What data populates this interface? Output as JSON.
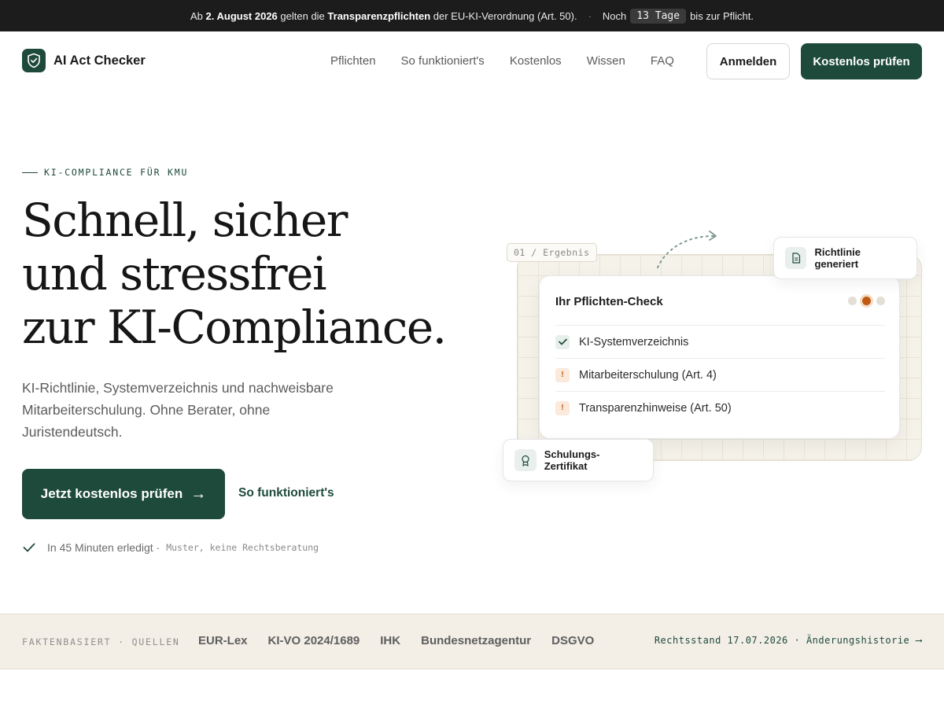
{
  "topbar": {
    "prefix": "Ab ",
    "date": "2. August 2026",
    "middle": " gelten die ",
    "duty": "Transparenzpflichten",
    "suffix": " der EU-KI-Verordnung (Art. 50).",
    "separator": "·",
    "countdown_prefix": "Noch",
    "countdown_value": "13 Tage",
    "countdown_suffix": "bis zur Pflicht."
  },
  "header": {
    "logo_text": "AI Act Checker",
    "logo_icon": "shield-check-icon",
    "nav": [
      "Pflichten",
      "So funktioniert's",
      "Kostenlos",
      "Wissen",
      "FAQ"
    ],
    "login_label": "Anmelden",
    "cta_label": "Kostenlos prüfen"
  },
  "hero": {
    "eyebrow": "KI-COMPLIANCE FÜR KMU",
    "headline": [
      "Schnell, sicher",
      "und stressfrei",
      "zur KI-Compliance."
    ],
    "subtext": "KI-Richtlinie, Systemverzeichnis und nachweisbare Mitarbeiterschulung. Ohne Berater, ohne Juristendeutsch.",
    "cta_primary": "Jetzt kostenlos prüfen",
    "cta_arrow": "→",
    "cta_secondary": "So funktioniert's",
    "note_text": "In 45 Minuten erledigt ·",
    "note_mono": "Muster, keine Rechtsberatung"
  },
  "illustration": {
    "result_tag": "01 / Ergebnis",
    "card_title": "Ihr Pflichten-Check",
    "rows": [
      {
        "label": "KI-Systemverzeichnis",
        "status": "ok",
        "icon": "check-icon"
      },
      {
        "label": "Mitarbeiterschulung (Art. 4)",
        "status": "warn",
        "icon": "exclamation-icon"
      },
      {
        "label": "Transparenzhinweise (Art. 50)",
        "status": "warn",
        "icon": "exclamation-icon"
      }
    ],
    "float_policy": "Richtlinie generiert",
    "float_policy_icon": "document-icon",
    "float_cert": "Schulungs-Zertifikat",
    "float_cert_icon": "award-icon",
    "accent_orange": "#c05a12",
    "accent_green": "#1e4a3b"
  },
  "sources_band": {
    "label": "FAKTENBASIERT · QUELLEN",
    "sources": [
      "EUR-Lex",
      "KI-VO 2024/1689",
      "IHK",
      "Bundesnetzagentur",
      "DSGVO"
    ],
    "legal_status": "Rechtsstand 17.07.2026 · Änderungshistorie",
    "legal_arrow": "⟶"
  },
  "colors": {
    "brand": "#1e4a3b",
    "topbar_bg": "#1c1c1c",
    "band_bg": "#f3efe7"
  }
}
